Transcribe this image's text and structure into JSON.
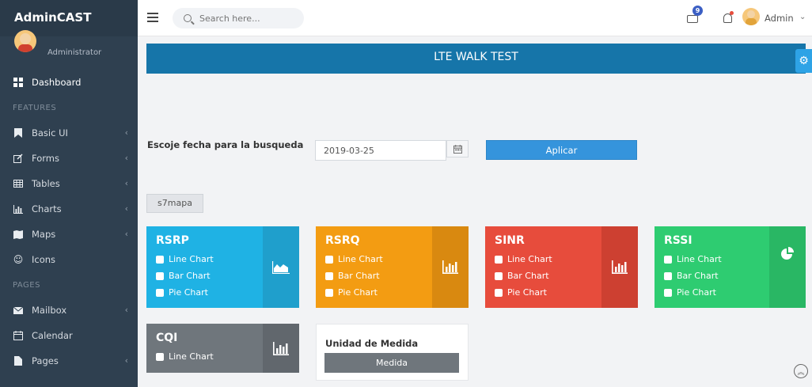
{
  "app": {
    "brand": "AdminCAST"
  },
  "user": {
    "role": "Administrator",
    "name": "Admin"
  },
  "header": {
    "search_placeholder": "Search here...",
    "mail_badge": "9"
  },
  "sidebar": {
    "items": [
      {
        "label": "Dashboard",
        "icon": "dashboard-icon"
      },
      {
        "heading": "FEATURES"
      },
      {
        "label": "Basic UI",
        "icon": "bookmark-icon"
      },
      {
        "label": "Forms",
        "icon": "edit-icon"
      },
      {
        "label": "Tables",
        "icon": "table-icon"
      },
      {
        "label": "Charts",
        "icon": "bar-chart-icon"
      },
      {
        "label": "Maps",
        "icon": "map-icon"
      },
      {
        "label": "Icons",
        "icon": "smile-icon"
      },
      {
        "heading": "PAGES"
      },
      {
        "label": "Mailbox",
        "icon": "envelope-icon"
      },
      {
        "label": "Calendar",
        "icon": "calendar-icon"
      },
      {
        "label": "Pages",
        "icon": "file-icon"
      }
    ]
  },
  "main": {
    "title": "LTE WALK TEST",
    "date_label": "Escoje fecha para la busqueda",
    "date_value": "2019-03-25",
    "apply_label": "Aplicar",
    "map_button": "s7mapa",
    "cards": [
      {
        "title": "RSRP",
        "options": [
          "Line Chart",
          "Bar Chart",
          "Pie Chart"
        ],
        "icon": "area-chart-icon",
        "color": "#1fb2e4"
      },
      {
        "title": "RSRQ",
        "options": [
          "Line Chart",
          "Bar Chart",
          "Pie Chart"
        ],
        "icon": "bar-chart-icon",
        "color": "#f39c12"
      },
      {
        "title": "SINR",
        "options": [
          "Line Chart",
          "Bar Chart",
          "Pie Chart"
        ],
        "icon": "bar-chart-icon",
        "color": "#e74c3c"
      },
      {
        "title": "RSSI",
        "options": [
          "Line Chart",
          "Bar Chart",
          "Pie Chart"
        ],
        "icon": "pie-chart-icon",
        "color": "#2ecc71"
      },
      {
        "title": "CQI",
        "options": [
          "Line Chart"
        ],
        "icon": "bar-chart-icon",
        "color": "#6f767c"
      }
    ],
    "unidad": {
      "title": "Unidad de Medida",
      "button": "Medida"
    }
  }
}
